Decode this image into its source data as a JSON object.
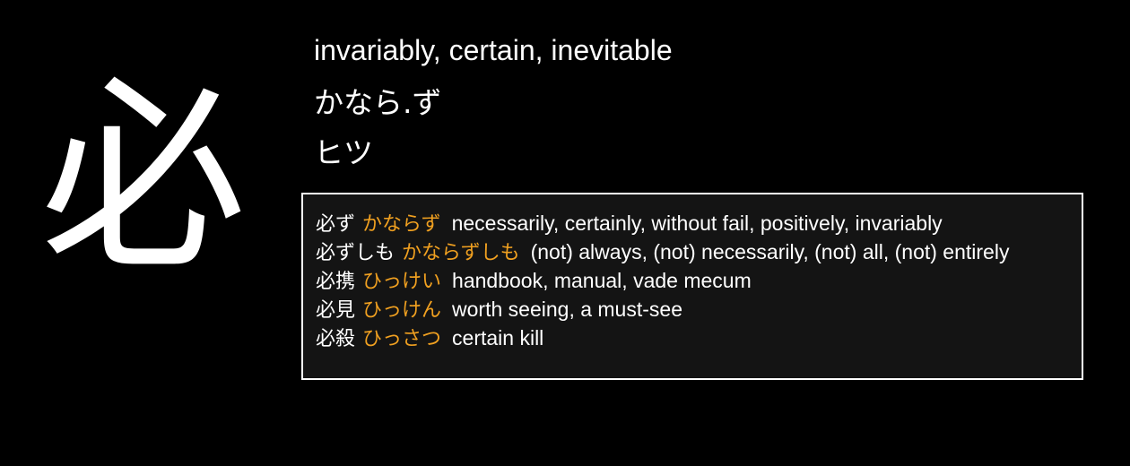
{
  "kanji": {
    "character": "必",
    "meaning": "invariably, certain, inevitable",
    "kun_reading": "かなら.ず",
    "on_reading": "ヒツ"
  },
  "vocabulary": [
    {
      "word": "必ず",
      "reading": "かならず",
      "gloss": "necessarily, certainly, without fail, positively, invariably"
    },
    {
      "word": "必ずしも",
      "reading": "かならずしも",
      "gloss": "(not) always, (not) necessarily, (not) all, (not) entirely"
    },
    {
      "word": "必携",
      "reading": "ひっけい",
      "gloss": "handbook, manual, vade mecum"
    },
    {
      "word": "必見",
      "reading": "ひっけん",
      "gloss": "worth seeing, a must-see"
    },
    {
      "word": "必殺",
      "reading": "ひっさつ",
      "gloss": "certain kill"
    }
  ],
  "colors": {
    "background": "#000000",
    "text": "#ffffff",
    "reading_accent": "#f0a020",
    "box_background": "#141414",
    "box_border": "#ffffff"
  }
}
